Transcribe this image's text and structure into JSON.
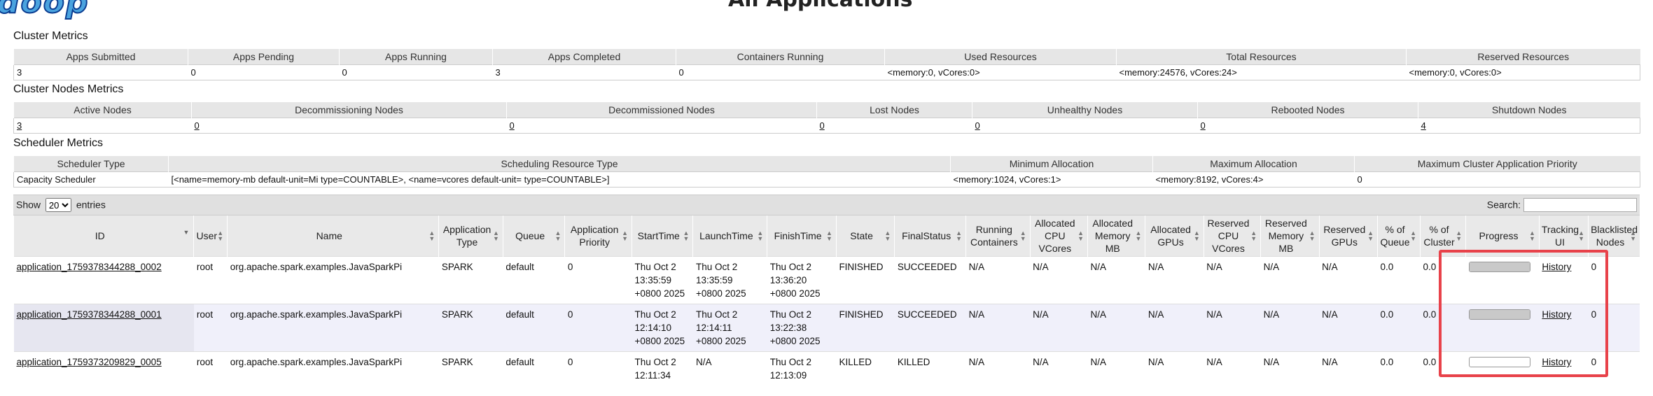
{
  "header": {
    "logo_text": "doop",
    "title": "All Applications"
  },
  "cluster_metrics": {
    "title": "Cluster Metrics",
    "headers": [
      "Apps Submitted",
      "Apps Pending",
      "Apps Running",
      "Apps Completed",
      "Containers Running",
      "Used Resources",
      "Total Resources",
      "Reserved Resources"
    ],
    "values": [
      "3",
      "0",
      "0",
      "3",
      "0",
      "<memory:0, vCores:0>",
      "<memory:24576, vCores:24>",
      "<memory:0, vCores:0>"
    ]
  },
  "cluster_nodes_metrics": {
    "title": "Cluster Nodes Metrics",
    "headers": [
      "Active Nodes",
      "Decommissioning Nodes",
      "Decommissioned Nodes",
      "Lost Nodes",
      "Unhealthy Nodes",
      "Rebooted Nodes",
      "Shutdown Nodes"
    ],
    "values": [
      "3",
      "0",
      "0",
      "0",
      "0",
      "0",
      "4"
    ]
  },
  "scheduler_metrics": {
    "title": "Scheduler Metrics",
    "headers": [
      "Scheduler Type",
      "Scheduling Resource Type",
      "Minimum Allocation",
      "Maximum Allocation",
      "Maximum Cluster Application Priority"
    ],
    "values": [
      "Capacity Scheduler",
      "[<name=memory-mb default-unit=Mi type=COUNTABLE>, <name=vcores default-unit= type=COUNTABLE>]",
      "<memory:1024, vCores:1>",
      "<memory:8192, vCores:4>",
      "0"
    ]
  },
  "apps_table": {
    "show_label": "Show",
    "entries_value": "20",
    "entries_label": "entries",
    "search_label": "Search:",
    "search_value": "",
    "columns": [
      "ID",
      "User",
      "Name",
      "Application Type",
      "Queue",
      "Application Priority",
      "StartTime",
      "LaunchTime",
      "FinishTime",
      "State",
      "FinalStatus",
      "Running Containers",
      "Allocated CPU VCores",
      "Allocated Memory MB",
      "Allocated GPUs",
      "Reserved CPU VCores",
      "Reserved Memory MB",
      "Reserved GPUs",
      "% of Queue",
      "% of Cluster",
      "Progress",
      "Tracking UI",
      "Blacklisted Nodes"
    ],
    "rows": [
      {
        "id": "application_1759378344288_0002",
        "user": "root",
        "name": "org.apache.spark.examples.JavaSparkPi",
        "type": "SPARK",
        "queue": "default",
        "priority": "0",
        "start": [
          "Thu Oct 2",
          "13:35:59",
          "+0800 2025"
        ],
        "launch": [
          "Thu Oct 2",
          "13:35:59",
          "+0800 2025"
        ],
        "finish": [
          "Thu Oct 2",
          "13:36:20",
          "+0800 2025"
        ],
        "state": "FINISHED",
        "final_status": "SUCCEEDED",
        "running_containers": "N/A",
        "alloc_vcores": "N/A",
        "alloc_mem": "N/A",
        "alloc_gpus": "N/A",
        "res_vcores": "N/A",
        "res_mem": "N/A",
        "res_gpus": "N/A",
        "pct_queue": "0.0",
        "pct_cluster": "0.0",
        "progress": 100,
        "tracking": "History",
        "blacklisted": "0"
      },
      {
        "id": "application_1759378344288_0001",
        "user": "root",
        "name": "org.apache.spark.examples.JavaSparkPi",
        "type": "SPARK",
        "queue": "default",
        "priority": "0",
        "start": [
          "Thu Oct 2",
          "12:14:10",
          "+0800 2025"
        ],
        "launch": [
          "Thu Oct 2",
          "12:14:11",
          "+0800 2025"
        ],
        "finish": [
          "Thu Oct 2",
          "13:22:38",
          "+0800 2025"
        ],
        "state": "FINISHED",
        "final_status": "SUCCEEDED",
        "running_containers": "N/A",
        "alloc_vcores": "N/A",
        "alloc_mem": "N/A",
        "alloc_gpus": "N/A",
        "res_vcores": "N/A",
        "res_mem": "N/A",
        "res_gpus": "N/A",
        "pct_queue": "0.0",
        "pct_cluster": "0.0",
        "progress": 100,
        "tracking": "History",
        "blacklisted": "0"
      },
      {
        "id": "application_1759373209829_0005",
        "user": "root",
        "name": "org.apache.spark.examples.JavaSparkPi",
        "type": "SPARK",
        "queue": "default",
        "priority": "0",
        "start": [
          "Thu Oct 2",
          "12:11:34",
          ""
        ],
        "launch": [
          "N/A",
          "",
          ""
        ],
        "finish": [
          "Thu Oct 2",
          "12:13:09",
          ""
        ],
        "state": "KILLED",
        "final_status": "KILLED",
        "running_containers": "N/A",
        "alloc_vcores": "N/A",
        "alloc_mem": "N/A",
        "alloc_gpus": "N/A",
        "res_vcores": "N/A",
        "res_mem": "N/A",
        "res_gpus": "N/A",
        "pct_queue": "0.0",
        "pct_cluster": "0.0",
        "progress": 0,
        "tracking": "History",
        "blacklisted": "0"
      }
    ]
  },
  "colors": {
    "highlight": "#e8424a",
    "header_bg": "#e6e6e6",
    "row_alt": "#f0f0fa"
  }
}
